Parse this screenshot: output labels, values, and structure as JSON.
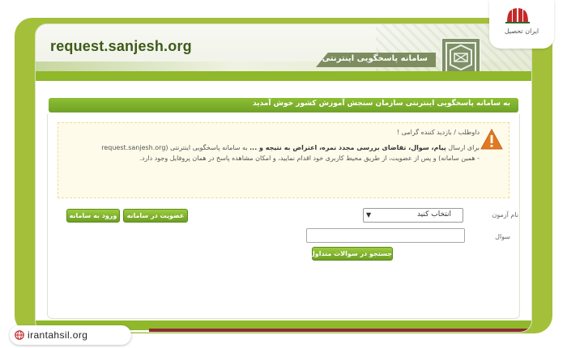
{
  "header": {
    "domain": "request.sanjesh.org",
    "subtitle": "سامانه پاسخگویی اینترنتی"
  },
  "brand": {
    "name": "ایران تحصیل"
  },
  "greenbar": {
    "welcome": "به سامانه پاسخگویی اینترنتی سازمان سنجش آموزش کشور خوش آمدید"
  },
  "notice": {
    "greeting": "داوطلب / بازدید کننده گرامی !",
    "body_intro": "برای ارسال",
    "body_bold": "پیام، سوال، تقاضای بررسی مجدد نمره، اعتراض به نتیجه و ...",
    "body_rest": "به سامانه پاسخگویی اینترنتی (request.sanjesh.org - همین سامانه) و پس از عضویت، از طریق محیط کاربری خود اقدام نمایید، و امکان مشاهده پاسخ در همان پروفایل وجود دارد."
  },
  "form": {
    "subject_label": "نام آزمون",
    "subject_value": "انتخاب کنید",
    "question_label": "سوال",
    "question_value": "",
    "search_button": "جستجو در سوالات متداول",
    "register_button": "عضویت در سامانه",
    "login_button": "ورود به سامانه"
  },
  "watermark": {
    "text": "irantahsil.org"
  },
  "colors": {
    "olive": "#a4c03a",
    "green": "#8fb82b",
    "button": "#7fb12f",
    "notice_bg": "#fefbea",
    "warning": "#e07a22"
  }
}
